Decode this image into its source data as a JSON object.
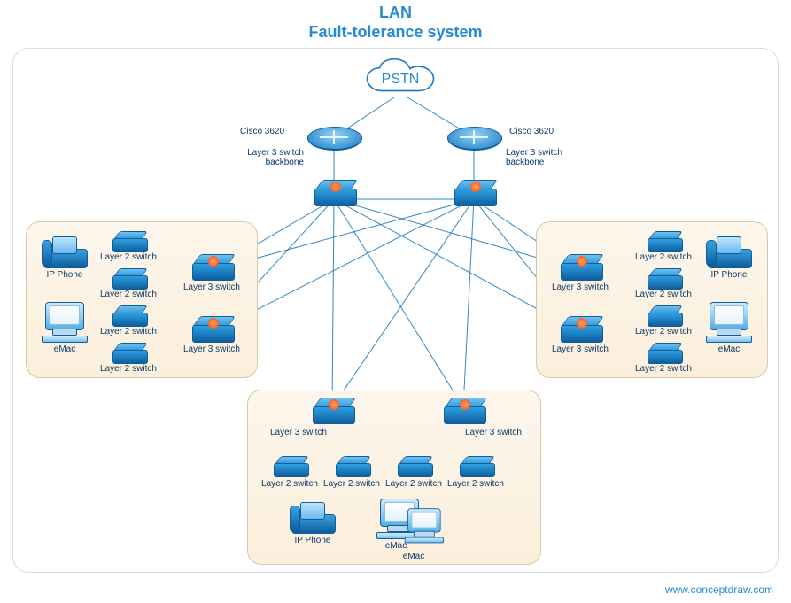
{
  "title_line1": "LAN",
  "title_line2": "Fault-tolerance system",
  "footer": "www.conceptdraw.com",
  "cloud_label": "PSTN",
  "router_left_label": "Cisco 3620",
  "router_right_label": "Cisco 3620",
  "backbone_left_label1": "Layer 3 switch",
  "backbone_left_label2": "backbone",
  "backbone_right_label1": "Layer 3 switch",
  "backbone_right_label2": "backbone",
  "left_group": {
    "ipphone": "IP Phone",
    "emac": "eMac",
    "l2_1": "Layer 2 switch",
    "l2_2": "Layer 2 switch",
    "l2_3": "Layer 2 switch",
    "l2_4": "Layer 2 switch",
    "l3_1": "Layer 3 switch",
    "l3_2": "Layer 3 switch"
  },
  "right_group": {
    "ipphone": "IP Phone",
    "emac": "eMac",
    "l2_1": "Layer 2 switch",
    "l2_2": "Layer 2 switch",
    "l2_3": "Layer 2 switch",
    "l2_4": "Layer 2 switch",
    "l3_1": "Layer 3 switch",
    "l3_2": "Layer 3 switch"
  },
  "bottom_group": {
    "ipphone": "IP Phone",
    "emac1": "eMac",
    "emac2": "eMac",
    "l2_1": "Layer 2 switch",
    "l2_2": "Layer 2 switch",
    "l2_3": "Layer 2 switch",
    "l2_4": "Layer 2 switch",
    "l3_1": "Layer 3 switch",
    "l3_2": "Layer 3 switch"
  }
}
